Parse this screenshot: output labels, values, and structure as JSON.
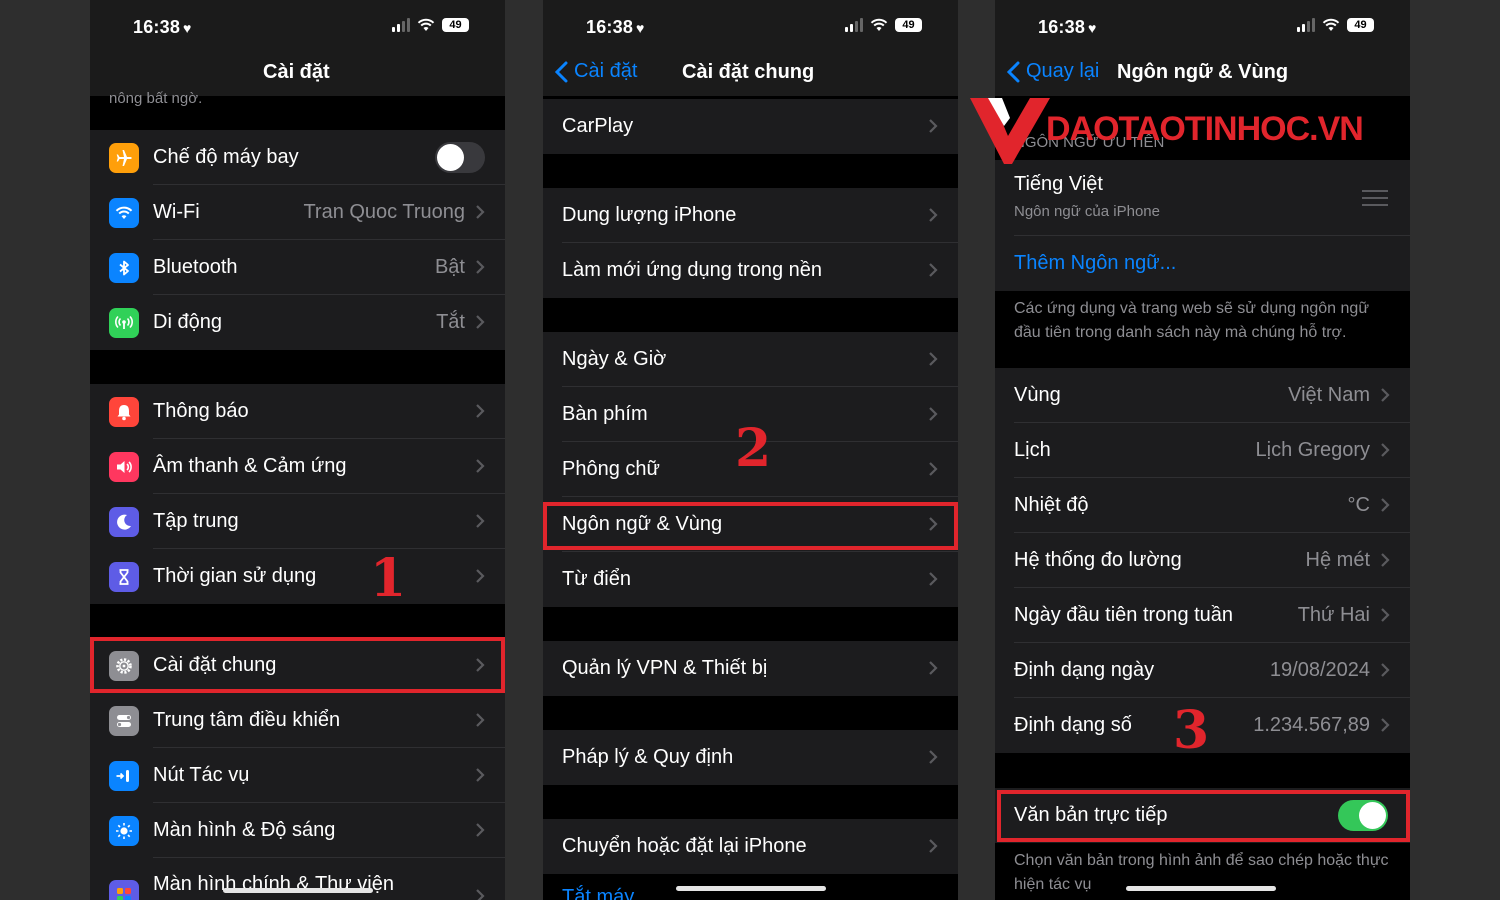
{
  "status": {
    "time": "16:38",
    "battery": "49"
  },
  "phone1": {
    "title": "Cài đặt",
    "cut_text": "nông bất ngờ.",
    "group1": [
      {
        "label": "Chế độ máy bay",
        "value": "",
        "icon": "airplane-icon",
        "color": "#ff9f0a"
      },
      {
        "label": "Wi-Fi",
        "value": "Tran Quoc Truong",
        "icon": "wifi-icon",
        "color": "#0a84ff"
      },
      {
        "label": "Bluetooth",
        "value": "Bật",
        "icon": "bluetooth-icon",
        "color": "#0a84ff"
      },
      {
        "label": "Di động",
        "value": "Tắt",
        "icon": "cellular-icon",
        "color": "#30d158"
      }
    ],
    "group2": [
      {
        "label": "Thông báo",
        "icon": "bell-icon",
        "color": "#ff453a"
      },
      {
        "label": "Âm thanh & Cảm ứng",
        "icon": "speaker-icon",
        "color": "#ff375f"
      },
      {
        "label": "Tập trung",
        "icon": "moon-icon",
        "color": "#5e5ce6"
      },
      {
        "label": "Thời gian sử dụng",
        "icon": "hourglass-icon",
        "color": "#5e5ce6"
      }
    ],
    "group3": [
      {
        "label": "Cài đặt chung",
        "icon": "gear-icon",
        "color": "#8e8e93"
      },
      {
        "label": "Trung tâm điều khiển",
        "icon": "switches-icon",
        "color": "#8e8e93"
      },
      {
        "label": "Nút Tác vụ",
        "icon": "action-button-icon",
        "color": "#0a84ff"
      },
      {
        "label": "Màn hình & Độ sáng",
        "icon": "sun-icon",
        "color": "#0a84ff"
      },
      {
        "label": "Màn hình chính & Thư viện",
        "icon": "grid-icon",
        "color": "#5e5ce6"
      }
    ],
    "step": "1"
  },
  "phone2": {
    "back": "Cài đặt",
    "title": "Cài đặt chung",
    "rows": [
      "CarPlay",
      "Dung lượng iPhone",
      "Làm mới ứng dụng trong nền",
      "Ngày & Giờ",
      "Bàn phím",
      "Phông chữ",
      "Ngôn ngữ & Vùng",
      "Từ điển",
      "Quản lý VPN & Thiết bị",
      "Pháp lý & Quy định",
      "Chuyển hoặc đặt lại iPhone"
    ],
    "cut_link": "Tắt máy",
    "step": "2"
  },
  "phone3": {
    "back": "Quay lại",
    "title": "Ngôn ngữ & Vùng",
    "section_header": "NGÔN NGỮ ƯU TIÊN",
    "language": "Tiếng Việt",
    "language_sub": "Ngôn ngữ của iPhone",
    "add_language": "Thêm Ngôn ngữ...",
    "language_note": "Các ứng dụng và trang web sẽ sử dụng ngôn ngữ đầu tiên trong danh sách này mà chúng hỗ trợ.",
    "rows": [
      {
        "label": "Vùng",
        "value": "Việt Nam"
      },
      {
        "label": "Lịch",
        "value": "Lịch Gregory"
      },
      {
        "label": "Nhiệt độ",
        "value": "°C"
      },
      {
        "label": "Hệ thống đo lường",
        "value": "Hệ mét"
      },
      {
        "label": "Ngày đầu tiên trong tuần",
        "value": "Thứ Hai"
      },
      {
        "label": "Định dạng ngày",
        "value": "19/08/2024"
      },
      {
        "label": "Định dạng số",
        "value": "1.234.567,89"
      }
    ],
    "live_text": "Văn bản trực tiếp",
    "live_text_note": "Chọn văn bản trong hình ảnh để sao chép hoặc thực hiện tác vụ",
    "step": "3"
  },
  "watermark": "DAOTAOTINHOC.VN",
  "colors": {
    "accent": "#0a84ff",
    "highlight": "#e1252c",
    "toggle_on": "#34c759"
  }
}
